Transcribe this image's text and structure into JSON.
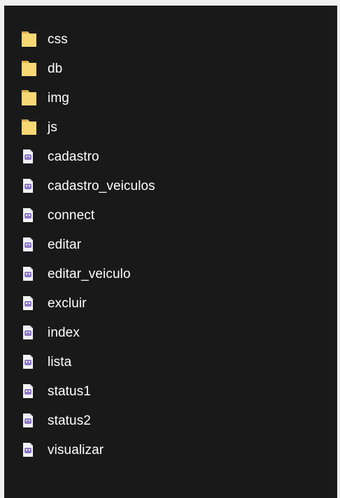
{
  "colors": {
    "background": "#191919",
    "frame": "#f0f0f0",
    "text": "#ffffff",
    "folder": "#f8d775",
    "folder_shade": "#d9b14d",
    "file_sheet": "#f3f3f8",
    "file_accent": "#8c7ac9"
  },
  "files": [
    {
      "name": "css",
      "icon": "folder-icon",
      "kind": "folder"
    },
    {
      "name": "db",
      "icon": "folder-icon",
      "kind": "folder"
    },
    {
      "name": "img",
      "icon": "folder-icon",
      "kind": "folder"
    },
    {
      "name": "js",
      "icon": "folder-icon",
      "kind": "folder"
    },
    {
      "name": "cadastro",
      "icon": "php-file-icon",
      "kind": "file"
    },
    {
      "name": "cadastro_veiculos",
      "icon": "php-file-icon",
      "kind": "file"
    },
    {
      "name": "connect",
      "icon": "php-file-icon",
      "kind": "file"
    },
    {
      "name": "editar",
      "icon": "php-file-icon",
      "kind": "file"
    },
    {
      "name": "editar_veiculo",
      "icon": "php-file-icon",
      "kind": "file"
    },
    {
      "name": "excluir",
      "icon": "php-file-icon",
      "kind": "file"
    },
    {
      "name": "index",
      "icon": "php-file-icon",
      "kind": "file"
    },
    {
      "name": "lista",
      "icon": "php-file-icon",
      "kind": "file"
    },
    {
      "name": "status1",
      "icon": "php-file-icon",
      "kind": "file"
    },
    {
      "name": "status2",
      "icon": "php-file-icon",
      "kind": "file"
    },
    {
      "name": "visualizar",
      "icon": "php-file-icon",
      "kind": "file"
    }
  ]
}
